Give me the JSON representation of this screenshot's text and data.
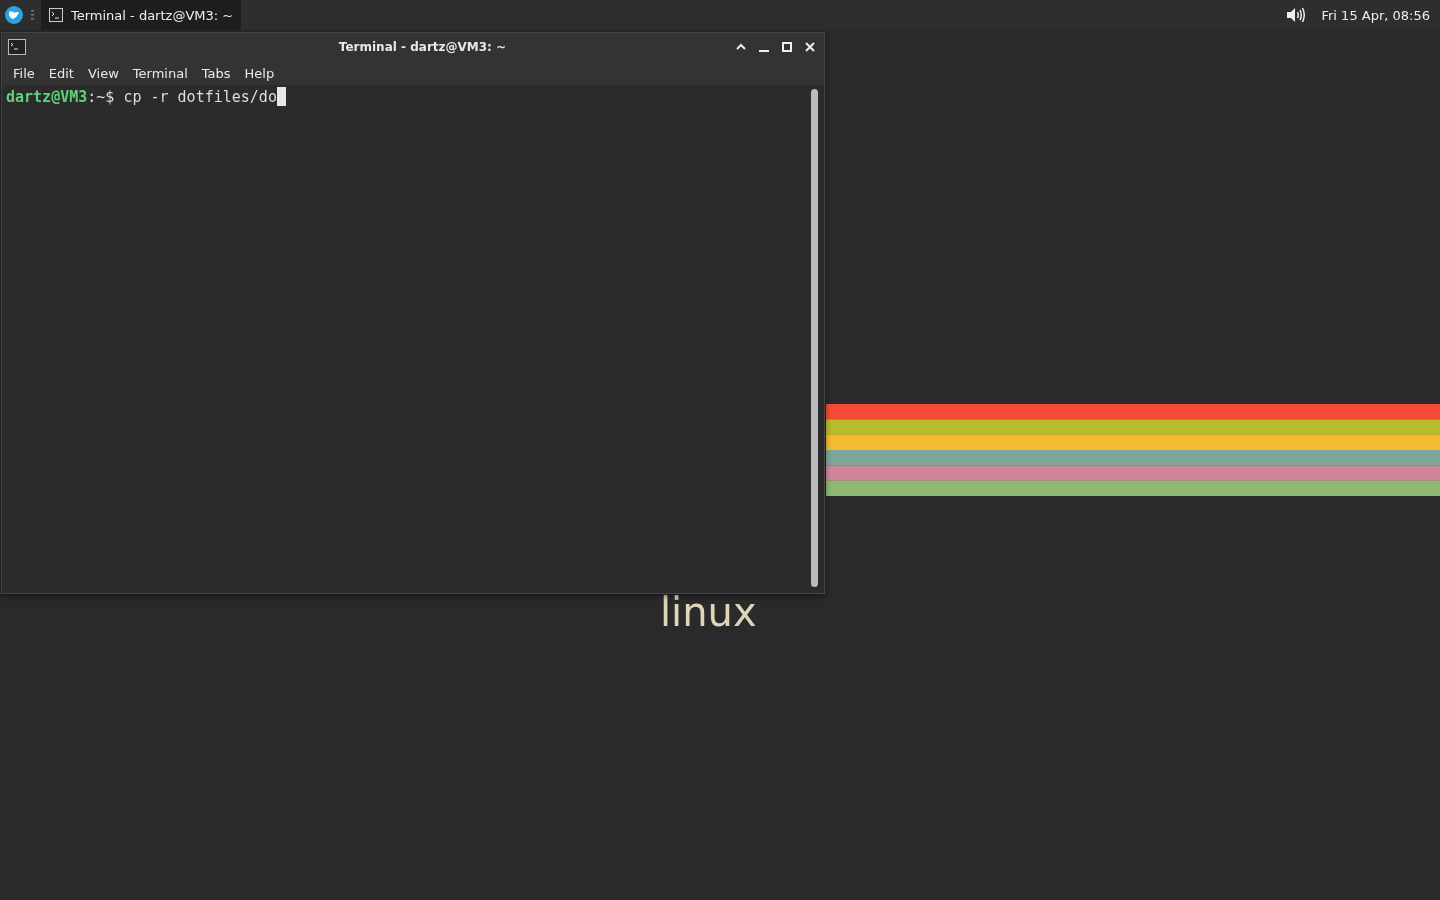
{
  "panel": {
    "tasks": [
      {
        "title": "Terminal - dartz@VM3: ~",
        "selected": true
      }
    ],
    "clock": "Fri 15 Apr, 08:56"
  },
  "window": {
    "title": "Terminal - dartz@VM3: ~",
    "menu": [
      "File",
      "Edit",
      "View",
      "Terminal",
      "Tabs",
      "Help"
    ],
    "prompt": {
      "user_host": "dartz@VM3",
      "path": ":~$",
      "command": "cp -r dotfiles/do"
    }
  },
  "wallpaper": {
    "text": "linux"
  }
}
